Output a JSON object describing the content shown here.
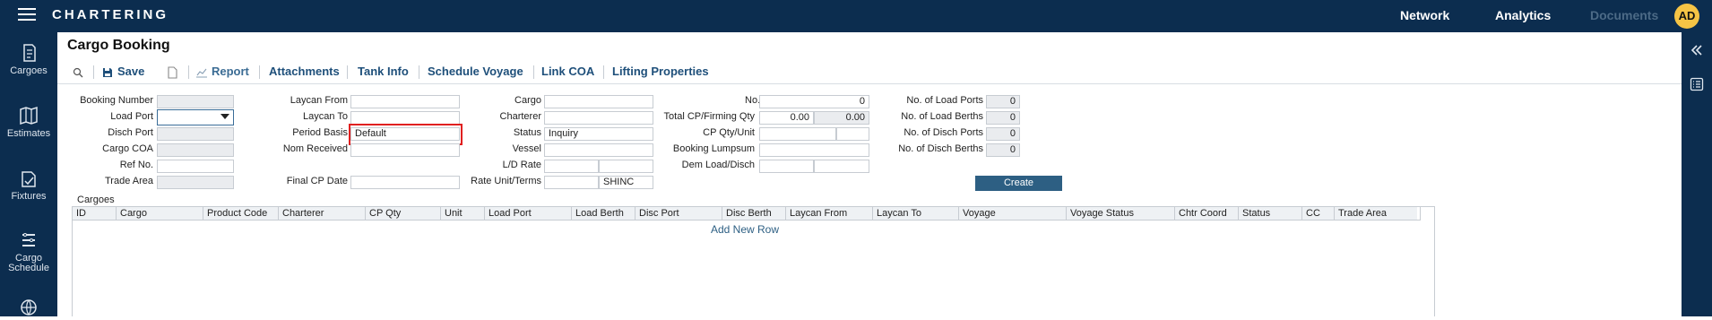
{
  "app": {
    "brand": "CHARTERING",
    "avatar_initials": "AD"
  },
  "topnav": {
    "network": "Network",
    "analytics": "Analytics",
    "documents": "Documents"
  },
  "leftnav": [
    {
      "label": "Cargoes",
      "icon": "cargoes-icon"
    },
    {
      "label": "Estimates",
      "icon": "map-icon"
    },
    {
      "label": "Fixtures",
      "icon": "fixtures-icon"
    },
    {
      "label": "Cargo Schedule",
      "icon": "cargo-schedule-icon"
    },
    {
      "label": "",
      "icon": "globe-icon"
    }
  ],
  "page": {
    "title": "Cargo Booking"
  },
  "toolbar": {
    "save": "Save",
    "report": "Report",
    "attachments": "Attachments",
    "tank_info": "Tank Info",
    "schedule_voyage": "Schedule Voyage",
    "link_coa": "Link COA",
    "lifting_properties": "Lifting Properties"
  },
  "form": {
    "col1": {
      "booking_number": {
        "label": "Booking Number",
        "value": ""
      },
      "load_port": {
        "label": "Load Port",
        "value": ""
      },
      "disch_port": {
        "label": "Disch Port",
        "value": ""
      },
      "cargo_coa": {
        "label": "Cargo COA",
        "value": ""
      },
      "ref_no": {
        "label": "Ref No.",
        "value": ""
      },
      "trade_area": {
        "label": "Trade Area",
        "value": ""
      }
    },
    "col2": {
      "laycan_from": {
        "label": "Laycan From",
        "value": ""
      },
      "laycan_to": {
        "label": "Laycan To",
        "value": ""
      },
      "period_basis": {
        "label": "Period Basis",
        "value": "Default"
      },
      "nom_received": {
        "label": "Nom Received",
        "value": ""
      },
      "final_cp_date": {
        "label": "Final CP Date",
        "value": ""
      }
    },
    "col3": {
      "cargo": {
        "label": "Cargo",
        "value": ""
      },
      "charterer": {
        "label": "Charterer",
        "value": ""
      },
      "status": {
        "label": "Status",
        "value": "Inquiry"
      },
      "vessel": {
        "label": "Vessel",
        "value": ""
      },
      "ld_rate": {
        "label": "L/D Rate",
        "value_a": "",
        "value_b": ""
      },
      "rate_unit_terms": {
        "label": "Rate Unit/Terms",
        "value_a": "",
        "value_b": "SHINC"
      }
    },
    "col4": {
      "no_of_cargoes": {
        "label": "No. of Cargoes",
        "value": "0"
      },
      "total_cp_firming_qty": {
        "label": "Total CP/Firming Qty",
        "value_a": "0.00",
        "value_b": "0.00"
      },
      "cp_qty_unit": {
        "label": "CP Qty/Unit",
        "value_a": "",
        "value_b": ""
      },
      "booking_lumpsum": {
        "label": "Booking Lumpsum",
        "value": ""
      },
      "dem_load_disch": {
        "label": "Dem Load/Disch",
        "value_a": "",
        "value_b": ""
      }
    },
    "col5": {
      "no_of_load_ports": {
        "label": "No. of Load Ports",
        "value": "0"
      },
      "no_of_load_berths": {
        "label": "No. of Load Berths",
        "value": "0"
      },
      "no_of_disch_ports": {
        "label": "No. of Disch Ports",
        "value": "0"
      },
      "no_of_disch_berths": {
        "label": "No. of Disch Berths",
        "value": "0"
      }
    },
    "create_button": "Create"
  },
  "cargoes": {
    "label": "Cargoes",
    "columns": [
      "ID",
      "Cargo",
      "Product Code",
      "Charterer",
      "CP Qty",
      "Unit",
      "Load Port",
      "Load Berth",
      "Disc Port",
      "Disc Berth",
      "Laycan From",
      "Laycan To",
      "Voyage",
      "Voyage Status",
      "Chtr Coord",
      "Status",
      "CC",
      "Trade Area"
    ],
    "add_row": "Add New Row"
  }
}
